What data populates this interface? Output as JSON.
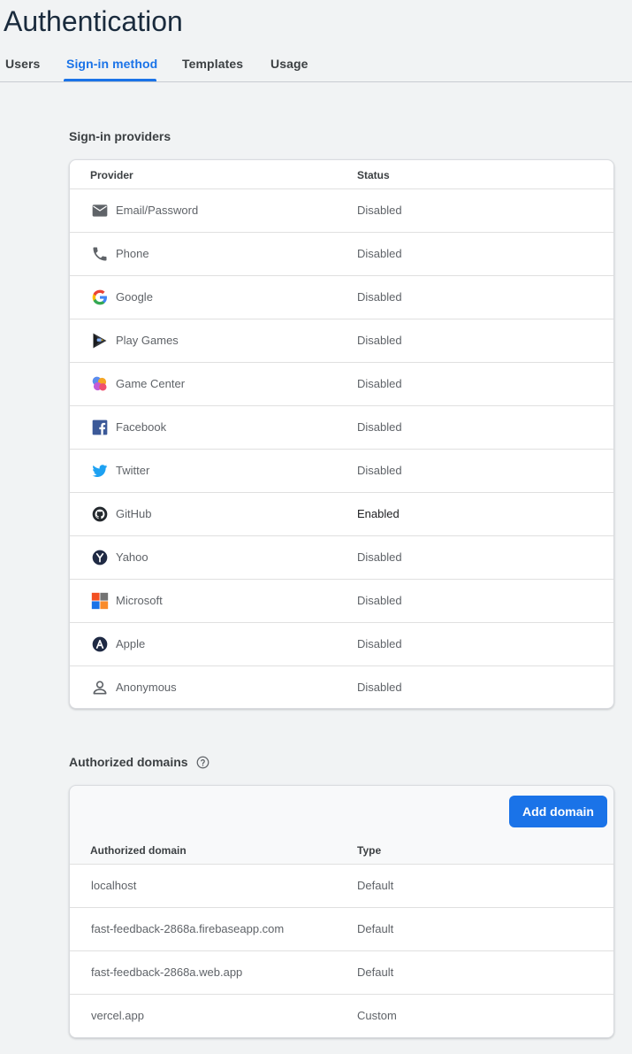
{
  "page": {
    "title": "Authentication"
  },
  "tabs": [
    {
      "label": "Users"
    },
    {
      "label": "Sign-in method"
    },
    {
      "label": "Templates"
    },
    {
      "label": "Usage"
    }
  ],
  "active_tab": "Sign-in method",
  "providers": {
    "title": "Sign-in providers",
    "columns": {
      "provider": "Provider",
      "status": "Status"
    },
    "rows": [
      {
        "name": "Email/Password",
        "status": "Disabled",
        "icon": "email-icon"
      },
      {
        "name": "Phone",
        "status": "Disabled",
        "icon": "phone-icon"
      },
      {
        "name": "Google",
        "status": "Disabled",
        "icon": "google-icon"
      },
      {
        "name": "Play Games",
        "status": "Disabled",
        "icon": "play-games-icon"
      },
      {
        "name": "Game Center",
        "status": "Disabled",
        "icon": "game-center-icon"
      },
      {
        "name": "Facebook",
        "status": "Disabled",
        "icon": "facebook-icon"
      },
      {
        "name": "Twitter",
        "status": "Disabled",
        "icon": "twitter-icon"
      },
      {
        "name": "GitHub",
        "status": "Enabled",
        "icon": "github-icon"
      },
      {
        "name": "Yahoo",
        "status": "Disabled",
        "icon": "yahoo-icon"
      },
      {
        "name": "Microsoft",
        "status": "Disabled",
        "icon": "microsoft-icon"
      },
      {
        "name": "Apple",
        "status": "Disabled",
        "icon": "apple-icon"
      },
      {
        "name": "Anonymous",
        "status": "Disabled",
        "icon": "anonymous-icon"
      }
    ]
  },
  "domains": {
    "title": "Authorized domains",
    "help_icon": "help-circle-icon",
    "add_button": "Add domain",
    "columns": {
      "domain": "Authorized domain",
      "type": "Type"
    },
    "rows": [
      {
        "domain": "localhost",
        "type": "Default"
      },
      {
        "domain": "fast-feedback-2868a.firebaseapp.com",
        "type": "Default"
      },
      {
        "domain": "fast-feedback-2868a.web.app",
        "type": "Default"
      },
      {
        "domain": "vercel.app",
        "type": "Custom"
      }
    ]
  },
  "colors": {
    "accent": "#1a73e8",
    "background": "#f1f3f4",
    "card": "#ffffff"
  }
}
